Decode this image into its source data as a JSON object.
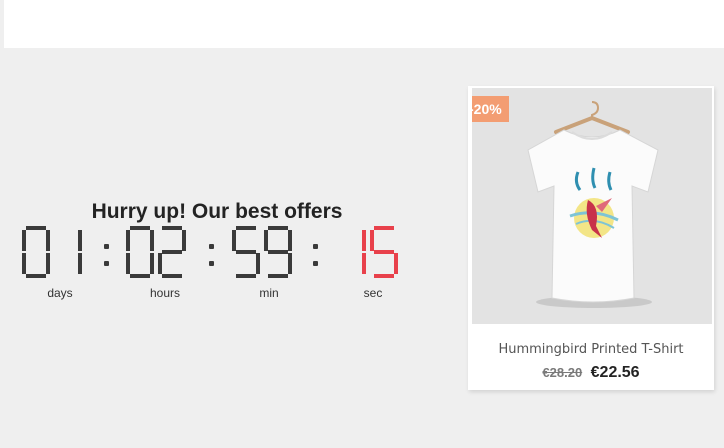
{
  "promo": {
    "title": "Hurry up! Our best offers",
    "countdown": {
      "days": "01",
      "hours": "02",
      "minutes": "59",
      "seconds": "15",
      "labels": {
        "days": "days",
        "hours": "hours",
        "min": "min",
        "sec": "sec"
      },
      "digit_color": "#3a3a3a",
      "seconds_color": "#e8414b"
    }
  },
  "product": {
    "name": "Hummingbird Printed T-Shirt",
    "discount_badge": "-20%",
    "old_price": "€28.20",
    "price": "€22.56",
    "badge_color": "#f39d72",
    "image_icon": "tshirt-hummingbird-image"
  }
}
